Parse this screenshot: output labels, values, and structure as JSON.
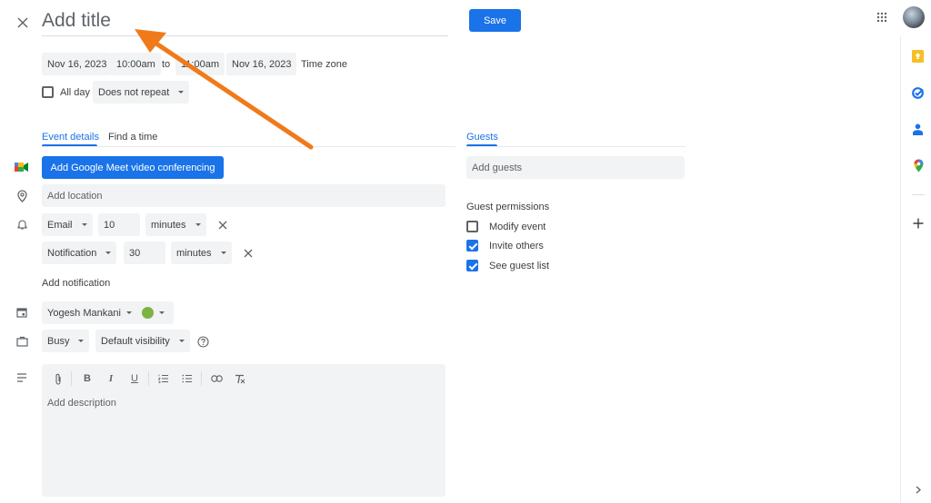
{
  "header": {
    "title_placeholder": "Add title",
    "save_label": "Save"
  },
  "datetime": {
    "start_date": "Nov 16, 2023",
    "start_time": "10:00am",
    "to_label": "to",
    "end_time": "11:00am",
    "end_date": "Nov 16, 2023",
    "timezone_label": "Time zone",
    "allday_label": "All day",
    "allday_checked": false,
    "repeat_value": "Does not repeat"
  },
  "tabs": [
    {
      "label": "Event details",
      "active": true
    },
    {
      "label": "Find a time",
      "active": false
    }
  ],
  "details": {
    "meet_button": "Add Google Meet video conferencing",
    "location_placeholder": "Add location",
    "notifications": [
      {
        "type": "Email",
        "amount": "10",
        "unit": "minutes"
      },
      {
        "type": "Notification",
        "amount": "30",
        "unit": "minutes"
      }
    ],
    "add_notification": "Add notification",
    "calendar_owner": "Yogesh Mankani",
    "event_color": "#7cb342",
    "availability": "Busy",
    "visibility": "Default visibility",
    "description_placeholder": "Add description"
  },
  "guests": {
    "tab_label": "Guests",
    "input_placeholder": "Add guests",
    "permissions_title": "Guest permissions",
    "permissions": [
      {
        "label": "Modify event",
        "checked": false
      },
      {
        "label": "Invite others",
        "checked": true
      },
      {
        "label": "See guest list",
        "checked": true
      }
    ]
  },
  "side_panel": {
    "items": [
      "keep-icon",
      "tasks-icon",
      "contacts-icon",
      "maps-icon"
    ]
  },
  "colors": {
    "accent": "#1a73e8",
    "annotation_arrow": "#f07a1a"
  }
}
